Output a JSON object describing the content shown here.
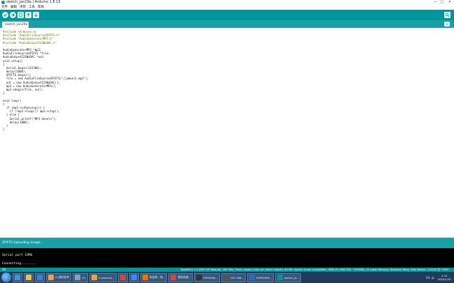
{
  "window": {
    "title": "sketch_jan29a | Arduino 1.8.10",
    "minimize": "—",
    "maximize": "□",
    "close": "✕"
  },
  "menu": [
    "文件",
    "编辑",
    "项目",
    "工具",
    "帮助"
  ],
  "toolbar": {
    "buttons": [
      "verify-icon",
      "upload-icon",
      "new-icon",
      "open-icon",
      "save-icon"
    ],
    "serial_monitor": "serial-monitor-icon"
  },
  "tab": {
    "label": "sketch_jan29a",
    "menu_icon": "▾"
  },
  "code": [
    "#include <Arduino.h>",
    "#include \"AudioFileSourceSPIFFS.h\"",
    "#include \"AudioGeneratorMP3.h\"",
    "#include \"AudioOutputI2SNoDAC.h\"",
    "",
    "AudioGeneratorMP3 *mp3;",
    "AudioFileSourceSPIFFS *file;",
    "AudioOutputI2SNoDAC *out;",
    "void setup()",
    "{",
    "  Serial.begin(115200);",
    "  delay(1000);",
    "  SPIFFS.begin();",
    "  file = new AudioFileSourceSPIFFS(\"/jamonit.mp3\");",
    "  out = new AudioOutputI2SNoDAC();",
    "  mp3 = new AudioGeneratorMP3();",
    "  mp3->begin(file, out);",
    "}",
    "",
    "void loop()",
    "{",
    "  if (mp3->isRunning()) {",
    "    if (!mp3->loop()) mp3->stop();",
    "  } else {",
    "    Serial.printf(\"MP3 done\\n\");",
    "    delay(1000);",
    "  }",
    "}"
  ],
  "status": {
    "message": "SPIFFS Uploading Image..."
  },
  "console": [
    "Serial port COM4",
    "",
    "Connecting........"
  ],
  "board": {
    "line_number": "28",
    "info": "NodeMCU 1.0 (ESP-12E Module), 160 MHz, Flash, Legacy (new can return nullptr), All SSL ciphers (most compatible), 4MB (FS:1MB OTA:~1019KB), v2 Lower Memory, Disabled, None, Only Sketch, 115200 在 COM4"
  },
  "taskbar": {
    "tasks": [
      {
        "label": "",
        "color": "#4a90d9"
      },
      {
        "label": "",
        "color": "#f0c040"
      },
      {
        "label": "",
        "color": "#3a7bd5"
      },
      {
        "label": "X:\\我的软件",
        "color": "#e8a33c"
      },
      {
        "label": "X:\\",
        "color": "#8aa0b8"
      },
      {
        "label": "C:\\Users\\X...",
        "color": "#e8a33c"
      },
      {
        "label": "",
        "color": "#d64541"
      },
      {
        "label": "",
        "color": "#4285f4"
      },
      {
        "label": "淘宝网 - 淘...",
        "color": "#ff6a00"
      },
      {
        "label": "搜狗高速...",
        "color": "#d64541"
      },
      {
        "label": "ESP8266...",
        "color": "#333333"
      },
      {
        "label": "192.168...",
        "color": "#555555"
      },
      {
        "label": "ESP8266F...",
        "color": "#2d6cb5"
      },
      {
        "label": "sketch_ja...",
        "color": "#00979c"
      }
    ],
    "tray": [
      "CH",
      "🔊"
    ],
    "time": "2:12",
    "date": "2020/1/31"
  }
}
